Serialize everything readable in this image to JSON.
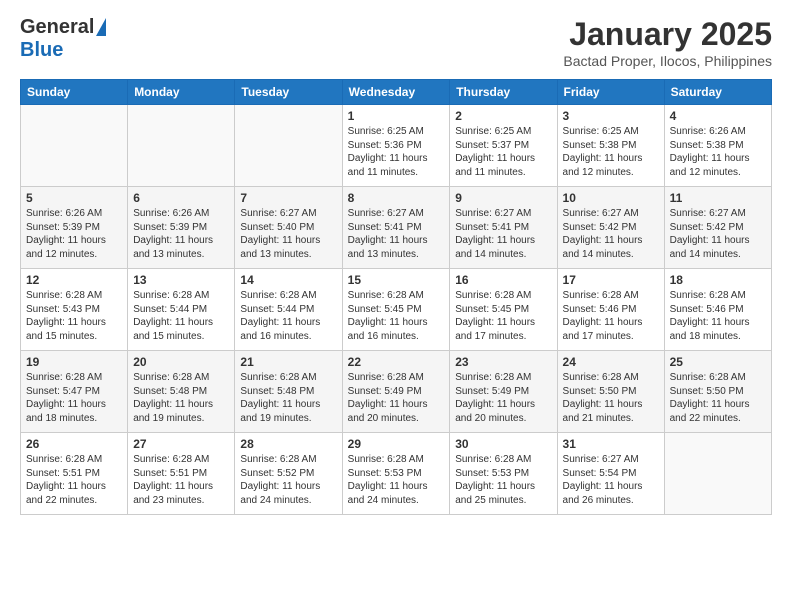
{
  "header": {
    "logo_general": "General",
    "logo_blue": "Blue",
    "month": "January 2025",
    "location": "Bactad Proper, Ilocos, Philippines"
  },
  "weekdays": [
    "Sunday",
    "Monday",
    "Tuesday",
    "Wednesday",
    "Thursday",
    "Friday",
    "Saturday"
  ],
  "weeks": [
    [
      {
        "day": "",
        "sunrise": "",
        "sunset": "",
        "daylight": ""
      },
      {
        "day": "",
        "sunrise": "",
        "sunset": "",
        "daylight": ""
      },
      {
        "day": "",
        "sunrise": "",
        "sunset": "",
        "daylight": ""
      },
      {
        "day": "1",
        "sunrise": "6:25 AM",
        "sunset": "5:36 PM",
        "daylight": "11 hours and 11 minutes."
      },
      {
        "day": "2",
        "sunrise": "6:25 AM",
        "sunset": "5:37 PM",
        "daylight": "11 hours and 11 minutes."
      },
      {
        "day": "3",
        "sunrise": "6:25 AM",
        "sunset": "5:38 PM",
        "daylight": "11 hours and 12 minutes."
      },
      {
        "day": "4",
        "sunrise": "6:26 AM",
        "sunset": "5:38 PM",
        "daylight": "11 hours and 12 minutes."
      }
    ],
    [
      {
        "day": "5",
        "sunrise": "6:26 AM",
        "sunset": "5:39 PM",
        "daylight": "11 hours and 12 minutes."
      },
      {
        "day": "6",
        "sunrise": "6:26 AM",
        "sunset": "5:39 PM",
        "daylight": "11 hours and 13 minutes."
      },
      {
        "day": "7",
        "sunrise": "6:27 AM",
        "sunset": "5:40 PM",
        "daylight": "11 hours and 13 minutes."
      },
      {
        "day": "8",
        "sunrise": "6:27 AM",
        "sunset": "5:41 PM",
        "daylight": "11 hours and 13 minutes."
      },
      {
        "day": "9",
        "sunrise": "6:27 AM",
        "sunset": "5:41 PM",
        "daylight": "11 hours and 14 minutes."
      },
      {
        "day": "10",
        "sunrise": "6:27 AM",
        "sunset": "5:42 PM",
        "daylight": "11 hours and 14 minutes."
      },
      {
        "day": "11",
        "sunrise": "6:27 AM",
        "sunset": "5:42 PM",
        "daylight": "11 hours and 14 minutes."
      }
    ],
    [
      {
        "day": "12",
        "sunrise": "6:28 AM",
        "sunset": "5:43 PM",
        "daylight": "11 hours and 15 minutes."
      },
      {
        "day": "13",
        "sunrise": "6:28 AM",
        "sunset": "5:44 PM",
        "daylight": "11 hours and 15 minutes."
      },
      {
        "day": "14",
        "sunrise": "6:28 AM",
        "sunset": "5:44 PM",
        "daylight": "11 hours and 16 minutes."
      },
      {
        "day": "15",
        "sunrise": "6:28 AM",
        "sunset": "5:45 PM",
        "daylight": "11 hours and 16 minutes."
      },
      {
        "day": "16",
        "sunrise": "6:28 AM",
        "sunset": "5:45 PM",
        "daylight": "11 hours and 17 minutes."
      },
      {
        "day": "17",
        "sunrise": "6:28 AM",
        "sunset": "5:46 PM",
        "daylight": "11 hours and 17 minutes."
      },
      {
        "day": "18",
        "sunrise": "6:28 AM",
        "sunset": "5:46 PM",
        "daylight": "11 hours and 18 minutes."
      }
    ],
    [
      {
        "day": "19",
        "sunrise": "6:28 AM",
        "sunset": "5:47 PM",
        "daylight": "11 hours and 18 minutes."
      },
      {
        "day": "20",
        "sunrise": "6:28 AM",
        "sunset": "5:48 PM",
        "daylight": "11 hours and 19 minutes."
      },
      {
        "day": "21",
        "sunrise": "6:28 AM",
        "sunset": "5:48 PM",
        "daylight": "11 hours and 19 minutes."
      },
      {
        "day": "22",
        "sunrise": "6:28 AM",
        "sunset": "5:49 PM",
        "daylight": "11 hours and 20 minutes."
      },
      {
        "day": "23",
        "sunrise": "6:28 AM",
        "sunset": "5:49 PM",
        "daylight": "11 hours and 20 minutes."
      },
      {
        "day": "24",
        "sunrise": "6:28 AM",
        "sunset": "5:50 PM",
        "daylight": "11 hours and 21 minutes."
      },
      {
        "day": "25",
        "sunrise": "6:28 AM",
        "sunset": "5:50 PM",
        "daylight": "11 hours and 22 minutes."
      }
    ],
    [
      {
        "day": "26",
        "sunrise": "6:28 AM",
        "sunset": "5:51 PM",
        "daylight": "11 hours and 22 minutes."
      },
      {
        "day": "27",
        "sunrise": "6:28 AM",
        "sunset": "5:51 PM",
        "daylight": "11 hours and 23 minutes."
      },
      {
        "day": "28",
        "sunrise": "6:28 AM",
        "sunset": "5:52 PM",
        "daylight": "11 hours and 24 minutes."
      },
      {
        "day": "29",
        "sunrise": "6:28 AM",
        "sunset": "5:53 PM",
        "daylight": "11 hours and 24 minutes."
      },
      {
        "day": "30",
        "sunrise": "6:28 AM",
        "sunset": "5:53 PM",
        "daylight": "11 hours and 25 minutes."
      },
      {
        "day": "31",
        "sunrise": "6:27 AM",
        "sunset": "5:54 PM",
        "daylight": "11 hours and 26 minutes."
      },
      {
        "day": "",
        "sunrise": "",
        "sunset": "",
        "daylight": ""
      }
    ]
  ],
  "labels": {
    "sunrise": "Sunrise:",
    "sunset": "Sunset:",
    "daylight": "Daylight:"
  }
}
